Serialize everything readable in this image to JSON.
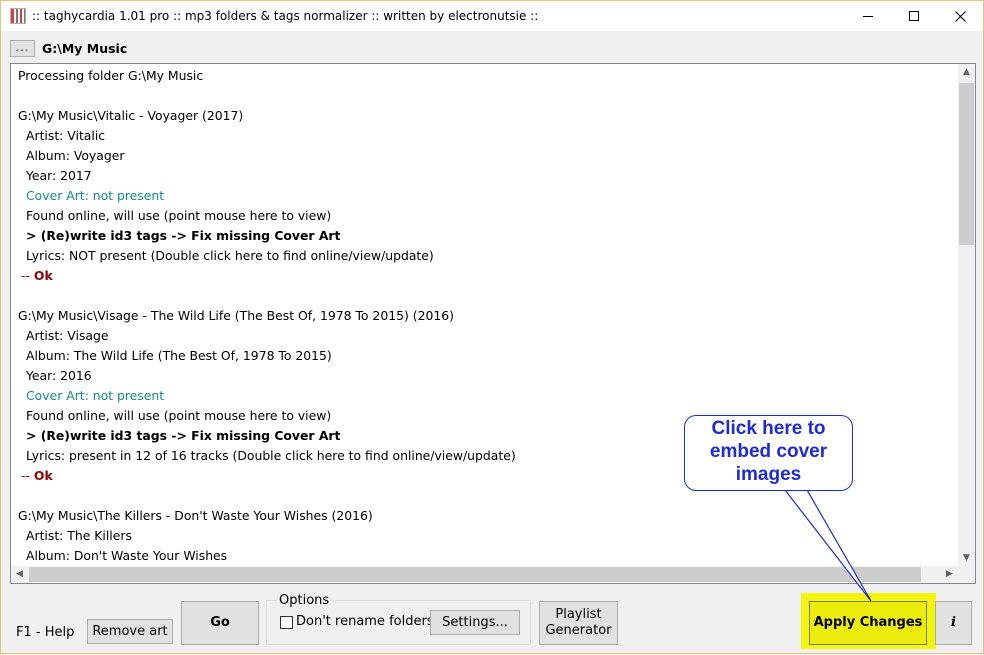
{
  "window": {
    "title": ":: taghycardia 1.01 pro :: mp3 folders & tags normalizer :: written by electronutsie ::",
    "minimize_symbol": "—",
    "maximize_symbol": "☐",
    "close_symbol": "✕"
  },
  "path_bar": {
    "browse_label": "...",
    "path": "G:\\My Music"
  },
  "log": {
    "line01": "Processing folder G:\\My Music",
    "line03": "G:\\My Music\\Vitalic - Voyager (2017)",
    "line04": "Artist: Vitalic",
    "line05": "Album: Voyager",
    "line06": "Year: 2017",
    "line07": "Cover Art: not present",
    "line08": "Found online, will use (point mouse here to view)",
    "line09": "> (Re)write id3 tags -> Fix missing Cover Art",
    "line10": "Lyrics: NOT present (Double click here to find online/view/update)",
    "line11_dash": "--",
    "line11_ok": "Ok",
    "line13": "G:\\My Music\\Visage - The Wild Life (The Best Of, 1978 To 2015) (2016)",
    "line14": "Artist: Visage",
    "line15": "Album: The Wild Life (The Best Of, 1978 To 2015)",
    "line16": "Year: 2016",
    "line17": "Cover Art: not present",
    "line18": "Found online, will use (point mouse here to view)",
    "line19": "> (Re)write id3 tags -> Fix missing Cover Art",
    "line20": "Lyrics: present in 12 of 16 tracks (Double click here to find online/view/update)",
    "line21_dash": "--",
    "line21_ok": "Ok",
    "line23": "G:\\My Music\\The Killers - Don't Waste Your Wishes (2016)",
    "line24": "Artist: The Killers",
    "line25": "Album: Don't Waste Your Wishes"
  },
  "scrollbar": {
    "up_arrow": "▲",
    "down_arrow": "▼",
    "left_arrow": "◀",
    "right_arrow": "▶"
  },
  "controls": {
    "help_label": "F1 - Help",
    "remove_art_label": "Remove art",
    "go_label": "Go",
    "options_legend": "Options",
    "dont_rename_label": "Don't rename folders",
    "dont_rename_checked": false,
    "settings_label": "Settings...",
    "playlist_line1": "Playlist",
    "playlist_line2": "Generator",
    "apply_label": "Apply Changes",
    "info_label": "i"
  },
  "callout": {
    "line1": "Click here to",
    "line2": "embed cover",
    "line3": "images"
  },
  "colors": {
    "cover_art_text": "#188a8a",
    "ok_text": "#8b0000",
    "callout": "#1d2ad8",
    "apply_highlight": "#f4f40d",
    "window_border": "#e5c37a"
  }
}
